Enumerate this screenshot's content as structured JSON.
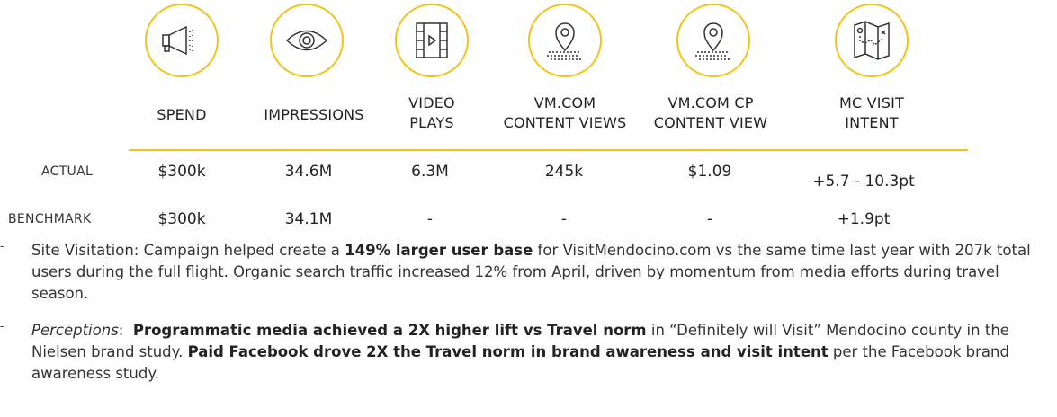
{
  "colors": {
    "accent": "#f2c417"
  },
  "columns": [
    {
      "icon": "megaphone-icon",
      "header": [
        "SPEND"
      ]
    },
    {
      "icon": "eye-icon",
      "header": [
        "IMPRESSIONS"
      ]
    },
    {
      "icon": "film-icon",
      "header": [
        "VIDEO",
        "PLAYS"
      ]
    },
    {
      "icon": "map-pin-icon",
      "header": [
        "VM.COM",
        "CONTENT VIEWS"
      ]
    },
    {
      "icon": "map-pin-icon",
      "header": [
        "VM.COM CP",
        "CONTENT VIEW"
      ]
    },
    {
      "icon": "map-icon",
      "header": [
        "MC VISIT",
        "INTENT"
      ]
    }
  ],
  "rows": [
    {
      "label": "ACTUAL",
      "values": [
        "$300k",
        "34.6M",
        "6.3M",
        "245k",
        "$1.09",
        "+5.7 - 10.3pt"
      ]
    },
    {
      "label": "BENCHMARK",
      "values": [
        "$300k",
        "34.1M",
        "-",
        "-",
        "-",
        "+1.9pt"
      ]
    }
  ],
  "bullets": [
    {
      "dash": "-",
      "prefix": "Site Visitation: Campaign helped create a ",
      "bold1": "149% larger user base",
      "text1": " for VisitMendocino.com vs the same time last year with 207k total users during the full flight. Organic search traffic increased 12% from April, driven by momentum from media efforts during travel season."
    },
    {
      "dash": "-",
      "italic": "Perceptions",
      "colon": ":  ",
      "bold1": "Programmatic media achieved a 2X higher lift vs Travel norm",
      "text1": " in “Definitely will Visit” Mendocino county in the Nielsen brand study. ",
      "bold2": "Paid Facebook drove 2X the Travel norm in brand awareness and visit intent",
      "text2": " per the Facebook brand awareness study."
    }
  ]
}
